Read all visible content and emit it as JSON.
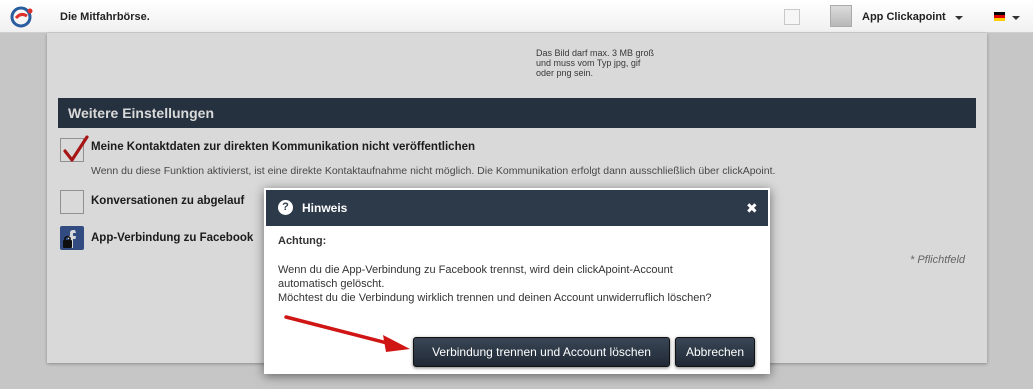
{
  "topbar": {
    "site_title": "Die Mitfahrbörse.",
    "app_name": "App Clickapoint",
    "language_flag": "de"
  },
  "page": {
    "image_hint": "Das Bild darf max. 3 MB groß und muss vom Typ jpg, gif oder png sein.",
    "section_title": "Weitere Einstellungen",
    "options": [
      {
        "label": "Meine Kontaktdaten zur direkten Kommunikation nicht veröffentlichen",
        "description": "Wenn du diese Funktion aktivierst, ist eine direkte Kontaktaufnahme nicht möglich. Die Kommunikation erfolgt dann ausschließlich über clickApoint.",
        "checked": true
      },
      {
        "label": "Konversationen zu abgelauf",
        "checked": false
      },
      {
        "label": "App-Verbindung zu Facebook"
      }
    ],
    "required_note": "* Pflichtfeld"
  },
  "dialog": {
    "title": "Hinweis",
    "attention": "Achtung:",
    "text_line1": "Wenn du die App-Verbindung zu Facebook trennst, wird dein clickApoint-Account\nautomatisch gelöscht.",
    "text_line2": "Möchtest du die Verbindung wirklich trennen und deinen Account unwiderruflich löschen?",
    "confirm_label": "Verbindung trennen und Account löschen",
    "cancel_label": "Abbrechen"
  },
  "colors": {
    "header_navy": "#2d3a4a",
    "arrow_red": "#d01515",
    "checkmark_red": "#c41a1a"
  }
}
